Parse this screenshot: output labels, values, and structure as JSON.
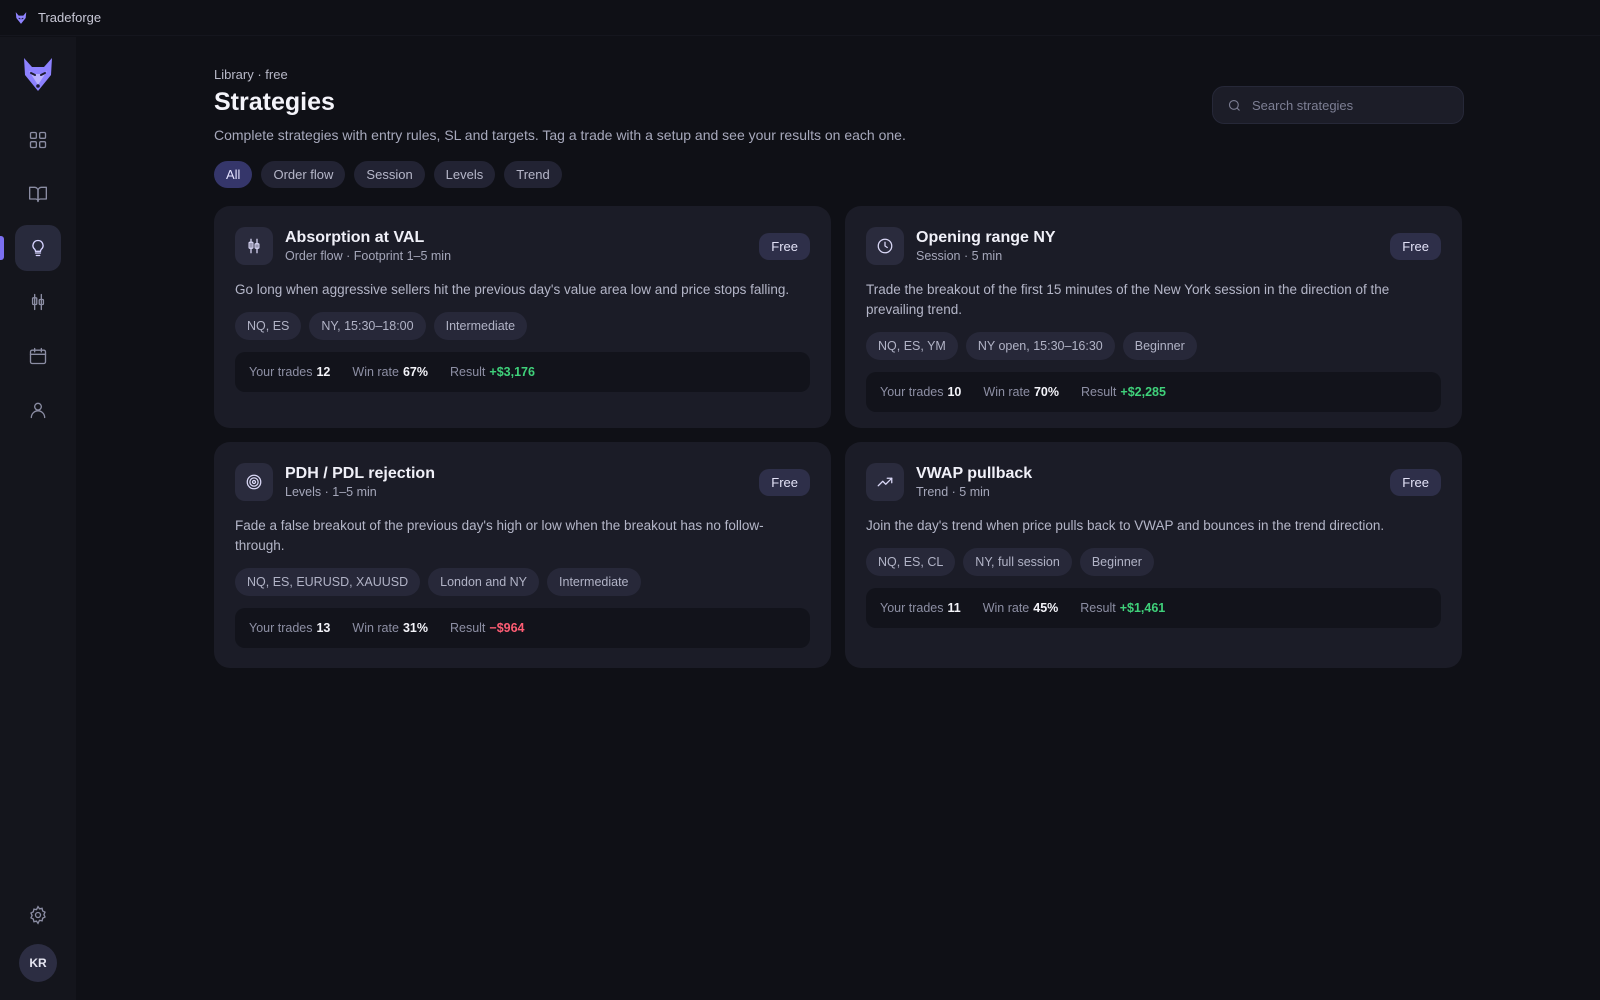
{
  "app": {
    "title": "Tradeforge"
  },
  "header": {
    "breadcrumb": "Library · free",
    "title": "Strategies",
    "subtitle": "Complete strategies with entry rules, SL and targets. Tag a trade with a setup and see your results on each one."
  },
  "search": {
    "placeholder": "Search strategies",
    "value": ""
  },
  "filters": [
    "All",
    "Order flow",
    "Session",
    "Levels",
    "Trend"
  ],
  "user": {
    "initials": "KR"
  },
  "colors": {
    "accent": "#7b6ff0",
    "positive": "#3fd17a",
    "negative": "#ff5d74"
  },
  "stat_labels": {
    "trades": "Your trades",
    "winrate": "Win rate",
    "result": "Result"
  },
  "cards": [
    {
      "icon": "candlestick-icon",
      "title": "Absorption at VAL",
      "meta": "Order flow · Footprint 1–5 min",
      "badge": "Free",
      "description": "Go long when aggressive sellers hit the previous day's value area low and price stops falling.",
      "tags": [
        "NQ, ES",
        "NY, 15:30–18:00",
        "Intermediate"
      ],
      "trades": "12",
      "winrate": "67%",
      "result": "+$3,176"
    },
    {
      "icon": "clock-icon",
      "title": "Opening range NY",
      "meta": "Session · 5 min",
      "badge": "Free",
      "description": "Trade the breakout of the first 15 minutes of the New York session in the direction of the prevailing trend.",
      "tags": [
        "NQ, ES, YM",
        "NY open, 15:30–16:30",
        "Beginner"
      ],
      "trades": "10",
      "winrate": "70%",
      "result": "+$2,285"
    },
    {
      "icon": "target-icon",
      "title": "PDH / PDL rejection",
      "meta": "Levels · 1–5 min",
      "badge": "Free",
      "description": "Fade a false breakout of the previous day's high or low when the breakout has no follow-through.",
      "tags": [
        "NQ, ES, EURUSD, XAUUSD",
        "London and NY",
        "Intermediate"
      ],
      "trades": "13",
      "winrate": "31%",
      "result": "−$964"
    },
    {
      "icon": "trending-up-icon",
      "title": "VWAP pullback",
      "meta": "Trend · 5 min",
      "badge": "Free",
      "description": "Join the day's trend when price pulls back to VWAP and bounces in the trend direction.",
      "tags": [
        "NQ, ES, CL",
        "NY, full session",
        "Beginner"
      ],
      "trades": "11",
      "winrate": "45%",
      "result": "+$1,461"
    }
  ]
}
